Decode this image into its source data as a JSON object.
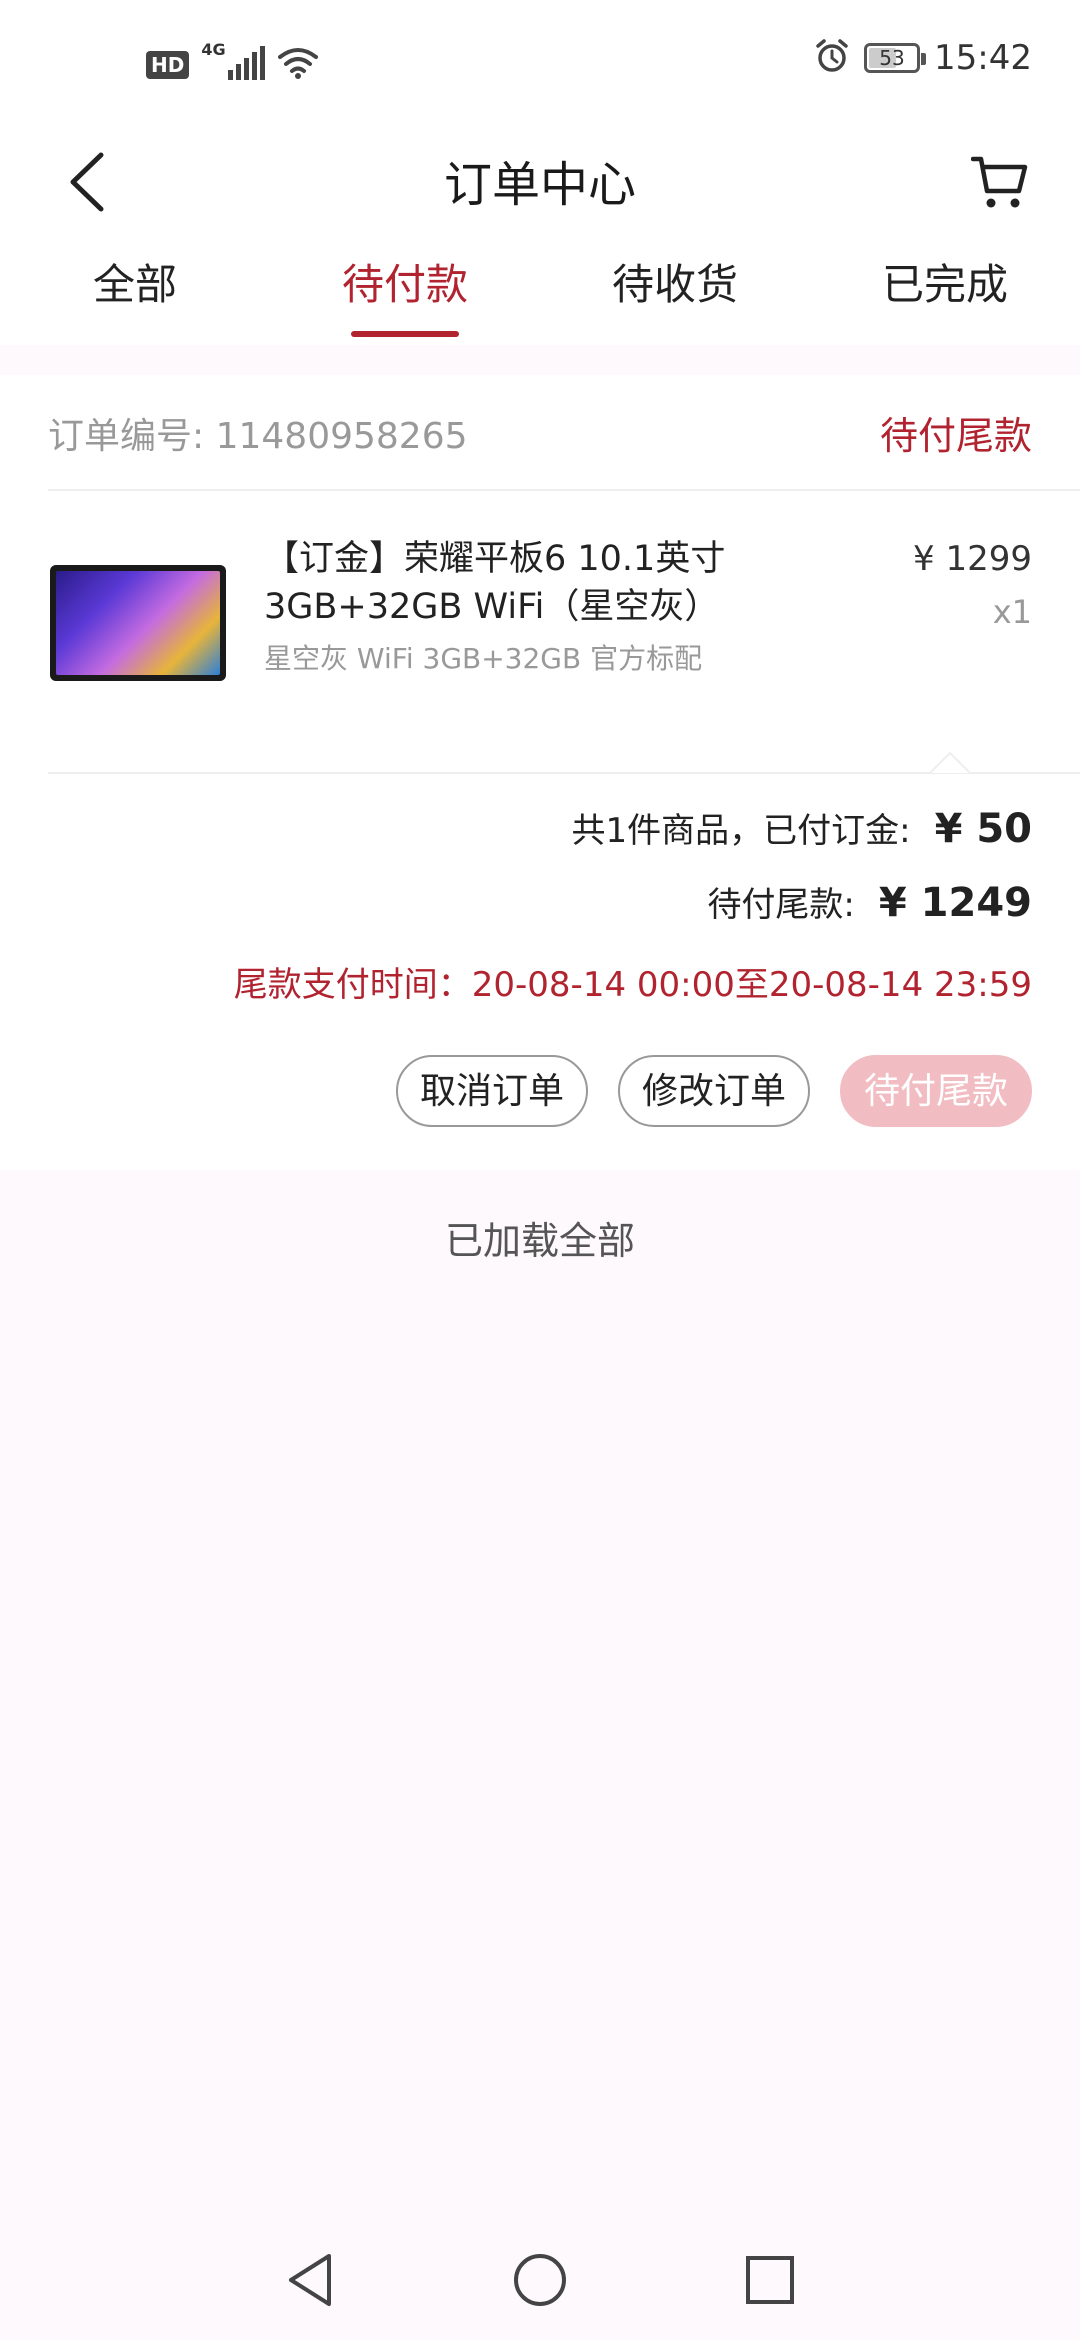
{
  "status_bar": {
    "hd": "HD",
    "network": "4G",
    "battery": "53",
    "battery_level": 0.53,
    "time": "15:42",
    "icons": [
      "signal-icon",
      "wifi-icon",
      "alarm-icon",
      "battery-icon"
    ]
  },
  "header": {
    "title": "订单中心",
    "back_icon": "back-arrow-icon",
    "cart_icon": "cart-icon"
  },
  "tabs": [
    {
      "label": "全部",
      "active": false
    },
    {
      "label": "待付款",
      "active": true
    },
    {
      "label": "待收货",
      "active": false
    },
    {
      "label": "已完成",
      "active": false
    }
  ],
  "order": {
    "number_label": "订单编号: 11480958265",
    "status": "待付尾款",
    "product": {
      "name": "【订金】荣耀平板6 10.1英寸 3GB+32GB WiFi（星空灰）",
      "spec": "星空灰 WiFi 3GB+32GB 官方标配",
      "price": "¥ 1299",
      "qty": "x1"
    },
    "summary": {
      "deposit_label": "共1件商品，已付订金:",
      "deposit_value": "¥ 50",
      "balance_label": "待付尾款:",
      "balance_value": "¥ 1249"
    },
    "pay_time": "尾款支付时间：20-08-14 00:00至20-08-14 23:59",
    "actions": {
      "cancel": "取消订单",
      "modify": "修改订单",
      "pay": "待付尾款"
    }
  },
  "footer_text": "已加载全部",
  "colors": {
    "accent": "#b22330",
    "pay_button": "#f1bcc2",
    "page_bg": "#fdf9fc"
  },
  "nav_bar": [
    "nav-back-icon",
    "nav-home-icon",
    "nav-recent-icon"
  ]
}
